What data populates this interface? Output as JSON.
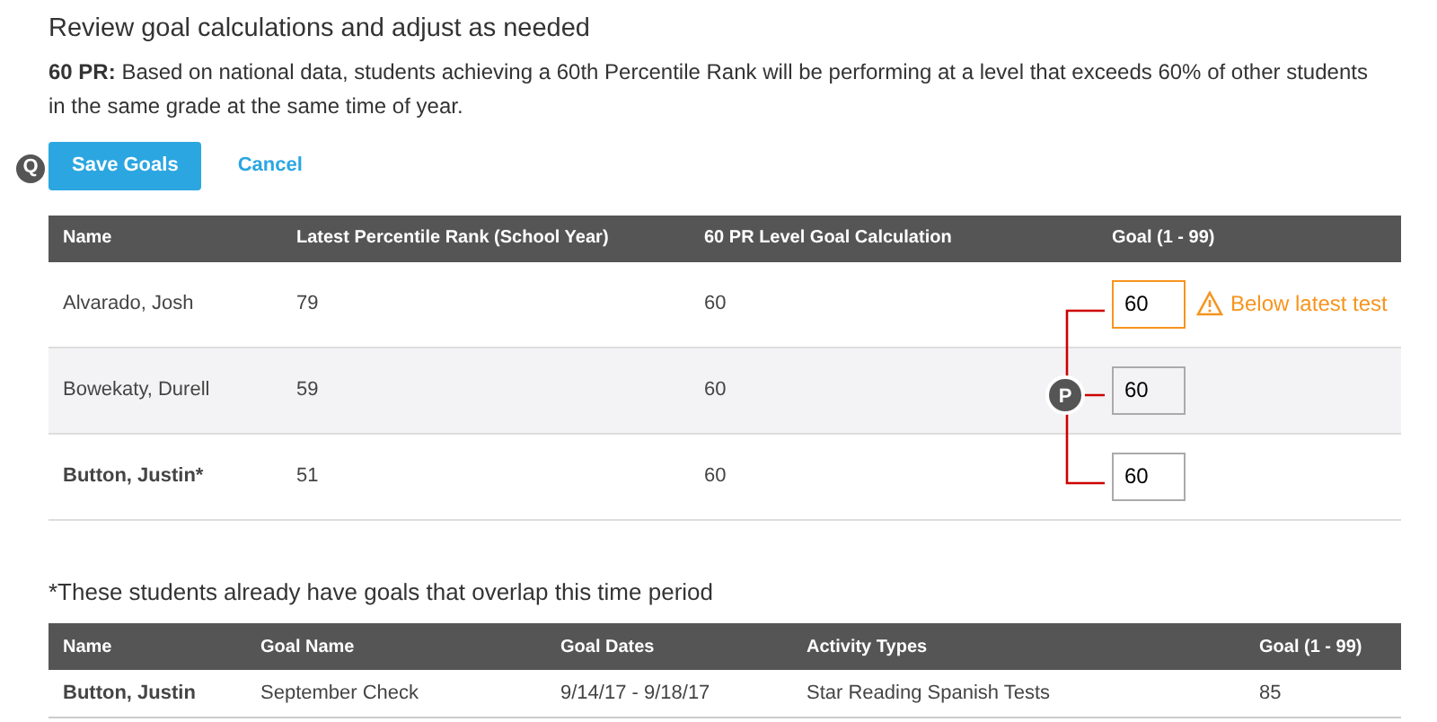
{
  "heading": "Review goal calculations and adjust as needed",
  "description": "**60 PR:** Based on national data, students achieving a 60th Percentile Rank will be performing at a level that exceeds 60% of other students in the same grade at the same time of year.",
  "callouts": [
    {
      "label": "Q"
    },
    {
      "label": "P"
    }
  ],
  "buttons": {
    "save": "Save Goals",
    "cancel": "Cancel"
  },
  "goals_table": {
    "columns": [
      "Name",
      "Latest Percentile Rank (School Year)",
      "60 PR Level Goal Calculation",
      "Goal (1 - 99)"
    ],
    "rows": [
      {
        "name": "Alvarado, Josh",
        "overlap": false,
        "latest": "79",
        "calculation": "60",
        "goal": "60",
        "warning": "Below latest test"
      },
      {
        "name": "Bowekaty, Durell",
        "overlap": false,
        "latest": "59",
        "calculation": "60",
        "goal": "60"
      },
      {
        "name": "Button, Justin*",
        "overlap": true,
        "latest": "51",
        "calculation": "60",
        "goal": "60"
      }
    ]
  },
  "overlap_note": "*These students already have goals that overlap this time period",
  "overlap_table": {
    "columns": [
      "Name",
      "Goal Name",
      "Goal Dates",
      "Activity Types",
      "Goal (1 - 99)"
    ],
    "rows": [
      {
        "name": "Button, Justin",
        "goal_name": "September Check",
        "dates": "9/14/17 - 9/18/17",
        "activity": "Star Reading Spanish Tests",
        "goal": "85"
      }
    ]
  }
}
